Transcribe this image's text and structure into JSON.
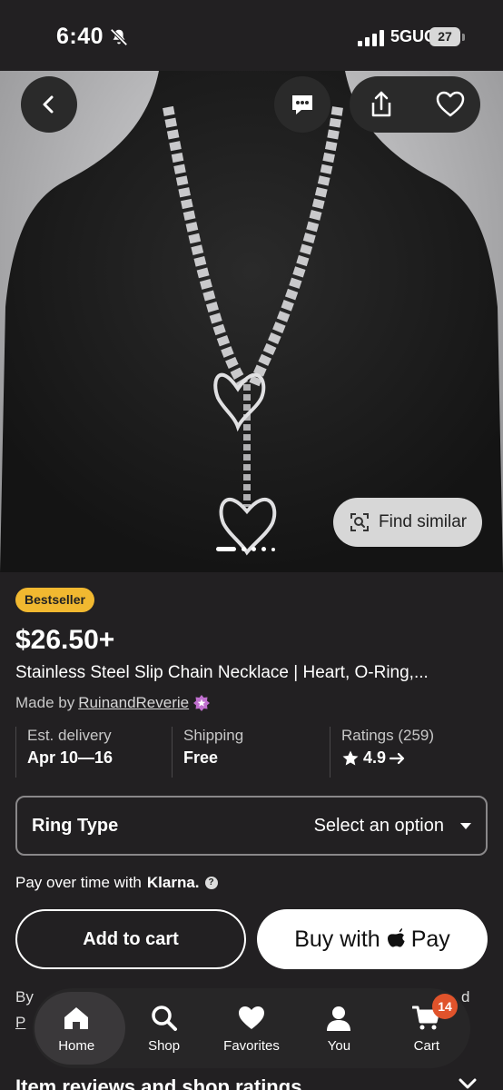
{
  "status_bar": {
    "time": "6:40",
    "network": "5GUC",
    "battery": "27"
  },
  "hero": {
    "find_similar_label": "Find similar",
    "carousel_dots": 5,
    "active_dot": 0
  },
  "product": {
    "badge": "Bestseller",
    "price": "$26.50+",
    "title": "Stainless Steel Slip Chain Necklace | Heart, O-Ring,...",
    "made_by_prefix": "Made by",
    "shop_name": "RuinandReverie"
  },
  "info": {
    "delivery_label": "Est. delivery",
    "delivery_value": "Apr 10—16",
    "shipping_label": "Shipping",
    "shipping_value": "Free",
    "ratings_label": "Ratings (259)",
    "ratings_value": "4.9"
  },
  "variation": {
    "label": "Ring Type",
    "value": "Select an option"
  },
  "klarna": {
    "text": "Pay over time with",
    "brand": "Klarna."
  },
  "actions": {
    "add_to_cart": "Add to cart",
    "buy_with": "Buy with",
    "pay_label": "Pay"
  },
  "footer_peek": {
    "by": "By",
    "right_char": "d",
    "p_link": "P",
    "reviews_heading": "Item reviews and shop ratings"
  },
  "tabbar": {
    "tabs": [
      {
        "label": "Home",
        "icon": "home-icon"
      },
      {
        "label": "Shop",
        "icon": "search-icon"
      },
      {
        "label": "Favorites",
        "icon": "heart-icon"
      },
      {
        "label": "You",
        "icon": "person-icon"
      },
      {
        "label": "Cart",
        "icon": "cart-icon"
      }
    ],
    "active_tab": "Home",
    "cart_count": "14"
  },
  "colors": {
    "background": "#222022",
    "badge": "#f1b830",
    "cart_badge": "#e0532b",
    "star_seller": "#c06fcf"
  }
}
